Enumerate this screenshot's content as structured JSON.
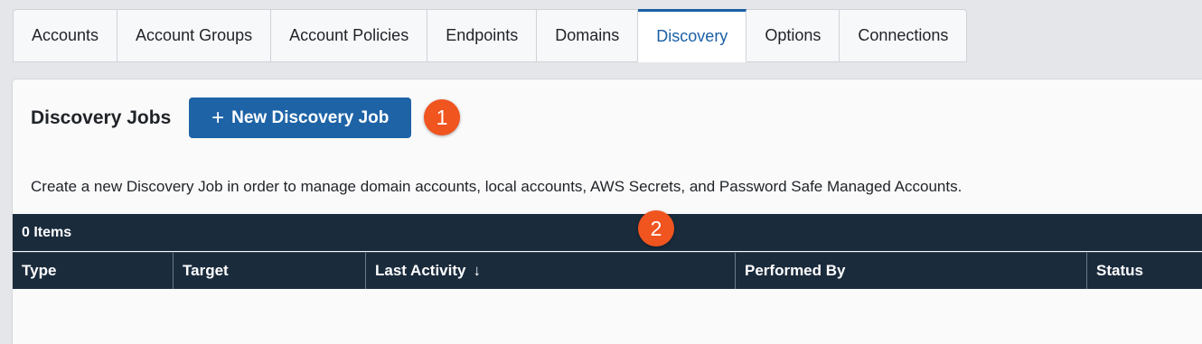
{
  "tabs": [
    {
      "label": "Accounts",
      "active": false
    },
    {
      "label": "Account Groups",
      "active": false
    },
    {
      "label": "Account Policies",
      "active": false
    },
    {
      "label": "Endpoints",
      "active": false
    },
    {
      "label": "Domains",
      "active": false
    },
    {
      "label": "Discovery",
      "active": true
    },
    {
      "label": "Options",
      "active": false
    },
    {
      "label": "Connections",
      "active": false
    }
  ],
  "page": {
    "title": "Discovery Jobs",
    "new_button": {
      "icon": "plus-icon",
      "label": "New Discovery Job"
    },
    "description": "Create a new Discovery Job in order to manage domain accounts, local accounts, AWS Secrets, and Password Safe Managed Accounts."
  },
  "callouts": {
    "first": "1",
    "second": "2"
  },
  "grid": {
    "item_count": "0 Items",
    "columns": {
      "type": "Type",
      "target": "Target",
      "last_activity": "Last Activity",
      "performed_by": "Performed By",
      "status": "Status"
    },
    "sort_icon": "↓",
    "rows": []
  },
  "colors": {
    "accent": "#1b5fa6",
    "button": "#1e63a6",
    "grid_header": "#1a2b3c",
    "callout": "#f0541f"
  }
}
